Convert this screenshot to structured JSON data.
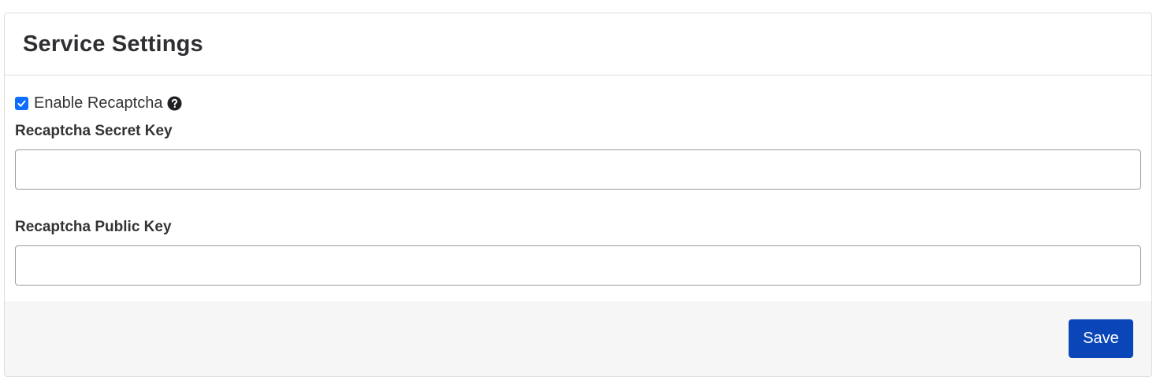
{
  "header": {
    "title": "Service Settings"
  },
  "recaptcha": {
    "enable_label": "Enable Recaptcha",
    "enabled": true,
    "help_icon": "question-circle-icon"
  },
  "fields": {
    "secret_key": {
      "label": "Recaptcha Secret Key",
      "value": "",
      "placeholder": ""
    },
    "public_key": {
      "label": "Recaptcha Public Key",
      "value": "",
      "placeholder": ""
    }
  },
  "footer": {
    "save_label": "Save"
  },
  "colors": {
    "accent": "#0d6efd",
    "save_button": "#0b46b8",
    "footer_background": "#f6f6f6"
  }
}
